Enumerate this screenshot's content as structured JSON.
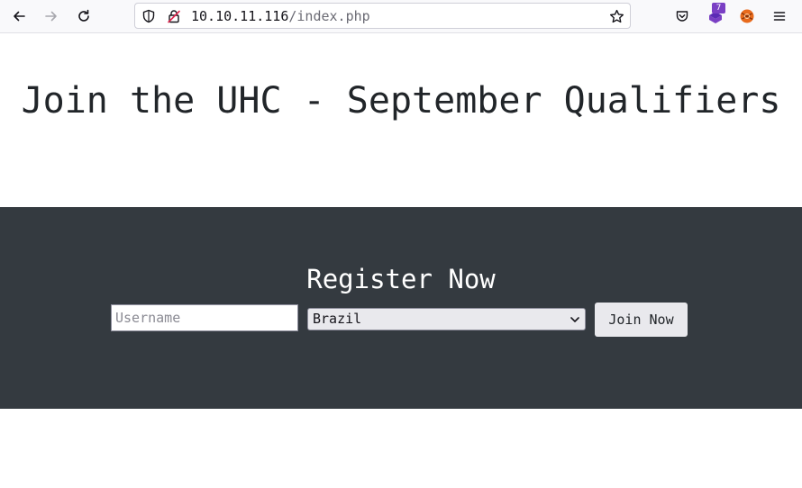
{
  "browser": {
    "url_host": "10.10.11.116",
    "url_path": "/index.php",
    "extension_badge": "7"
  },
  "page": {
    "title": "Join the UHC - September Qualifiers",
    "register": {
      "heading": "Register Now",
      "username_placeholder": "Username",
      "country_selected": "Brazil",
      "submit_label": "Join Now"
    }
  },
  "colors": {
    "register_bg": "#343a40",
    "heading_text": "#212529",
    "badge": "#7a3fc4"
  }
}
